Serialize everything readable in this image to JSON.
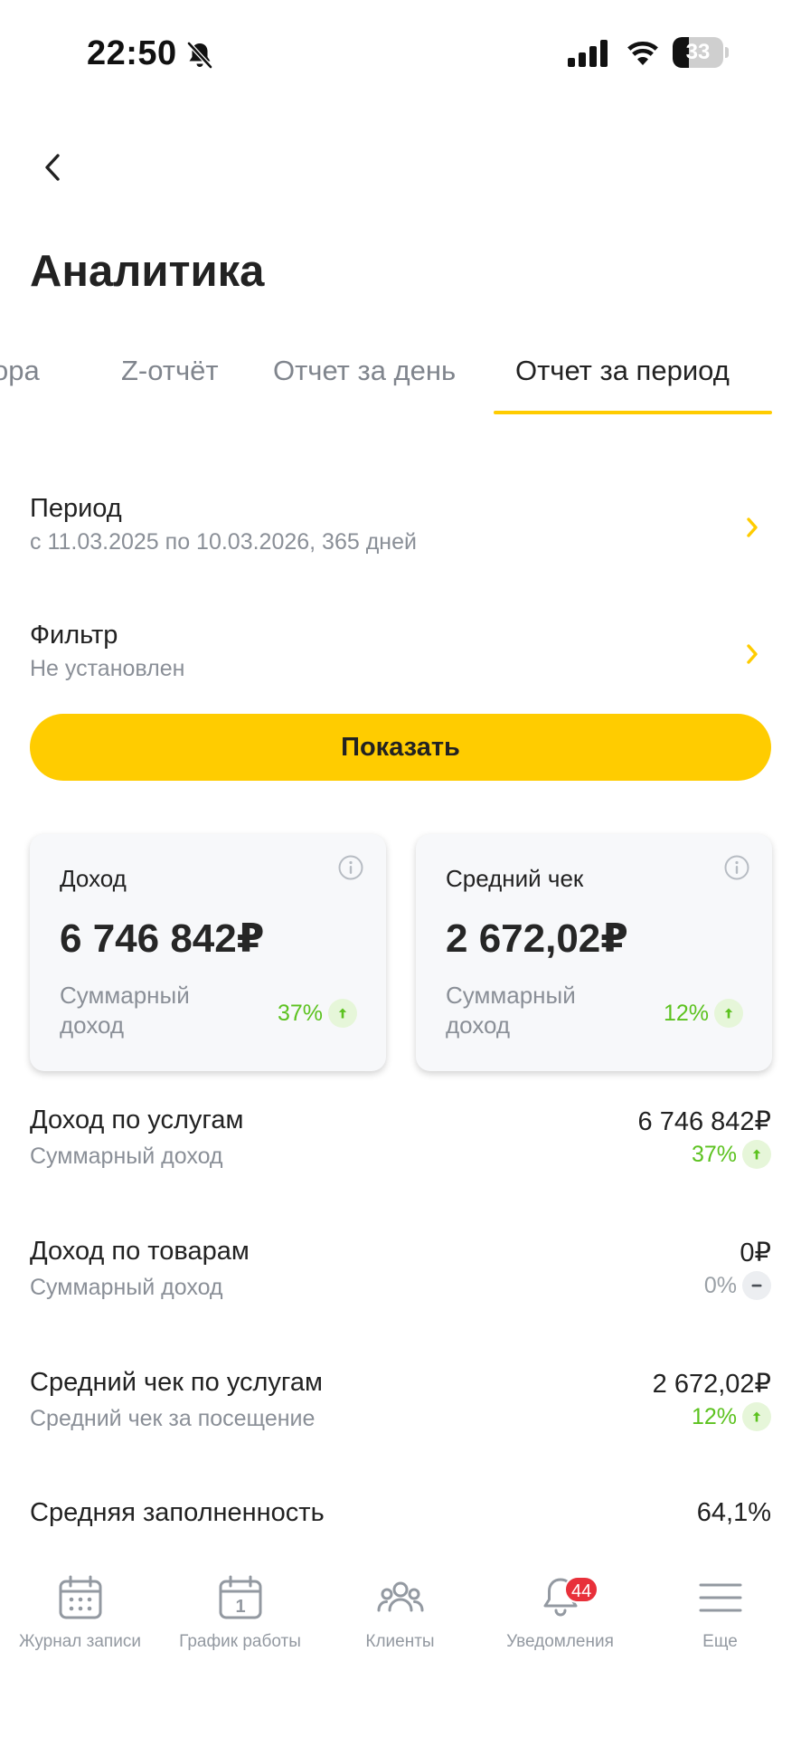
{
  "status_bar": {
    "time": "22:50",
    "battery": "33",
    "battery_level": 0.33
  },
  "header": {
    "title": "Аналитика"
  },
  "tabs": [
    {
      "label": "ора"
    },
    {
      "label": "Z-отчёт"
    },
    {
      "label": "Отчет за день"
    },
    {
      "label": "Отчет за период",
      "active": true
    }
  ],
  "period": {
    "title": "Период",
    "value": "с 11.03.2025 по 10.03.2026, 365 дней"
  },
  "filter": {
    "title": "Фильтр",
    "value": "Не установлен"
  },
  "show_button": {
    "label": "Показать"
  },
  "cards": [
    {
      "title": "Доход",
      "value": "6 746 842₽",
      "desc": "Суммарный доход",
      "trend": "37%",
      "trend_dir": "up"
    },
    {
      "title": "Средний чек",
      "value": "2 672,02₽",
      "desc": "Суммарный доход",
      "trend": "12%",
      "trend_dir": "up"
    }
  ],
  "metrics": [
    {
      "title": "Доход по услугам",
      "sub": "Суммарный доход",
      "value": "6 746 842₽",
      "trend": "37%",
      "trend_dir": "up"
    },
    {
      "title": "Доход по товарам",
      "sub": "Суммарный доход",
      "value": "0₽",
      "trend": "0%",
      "trend_dir": "neutral"
    },
    {
      "title": "Средний чек по услугам",
      "sub": "Средний чек за посещение",
      "value": "2 672,02₽",
      "trend": "12%",
      "trend_dir": "up"
    },
    {
      "title": "Средняя заполненность",
      "value": "64,1%"
    }
  ],
  "nav": {
    "items": [
      {
        "label": "Журнал записи",
        "icon": "calendar-grid-icon"
      },
      {
        "label": "График работы",
        "icon": "calendar-day-icon",
        "icon_text": "1"
      },
      {
        "label": "Клиенты",
        "icon": "users-icon"
      },
      {
        "label": "Уведомления",
        "icon": "bell-icon"
      },
      {
        "label": "Еще",
        "icon": "menu-icon"
      }
    ],
    "notifications_count": "44"
  },
  "colors": {
    "accent": "#ffcc00",
    "trend_up": "#5cc21f",
    "badge": "#e8303a",
    "muted": "#8a8f97"
  }
}
